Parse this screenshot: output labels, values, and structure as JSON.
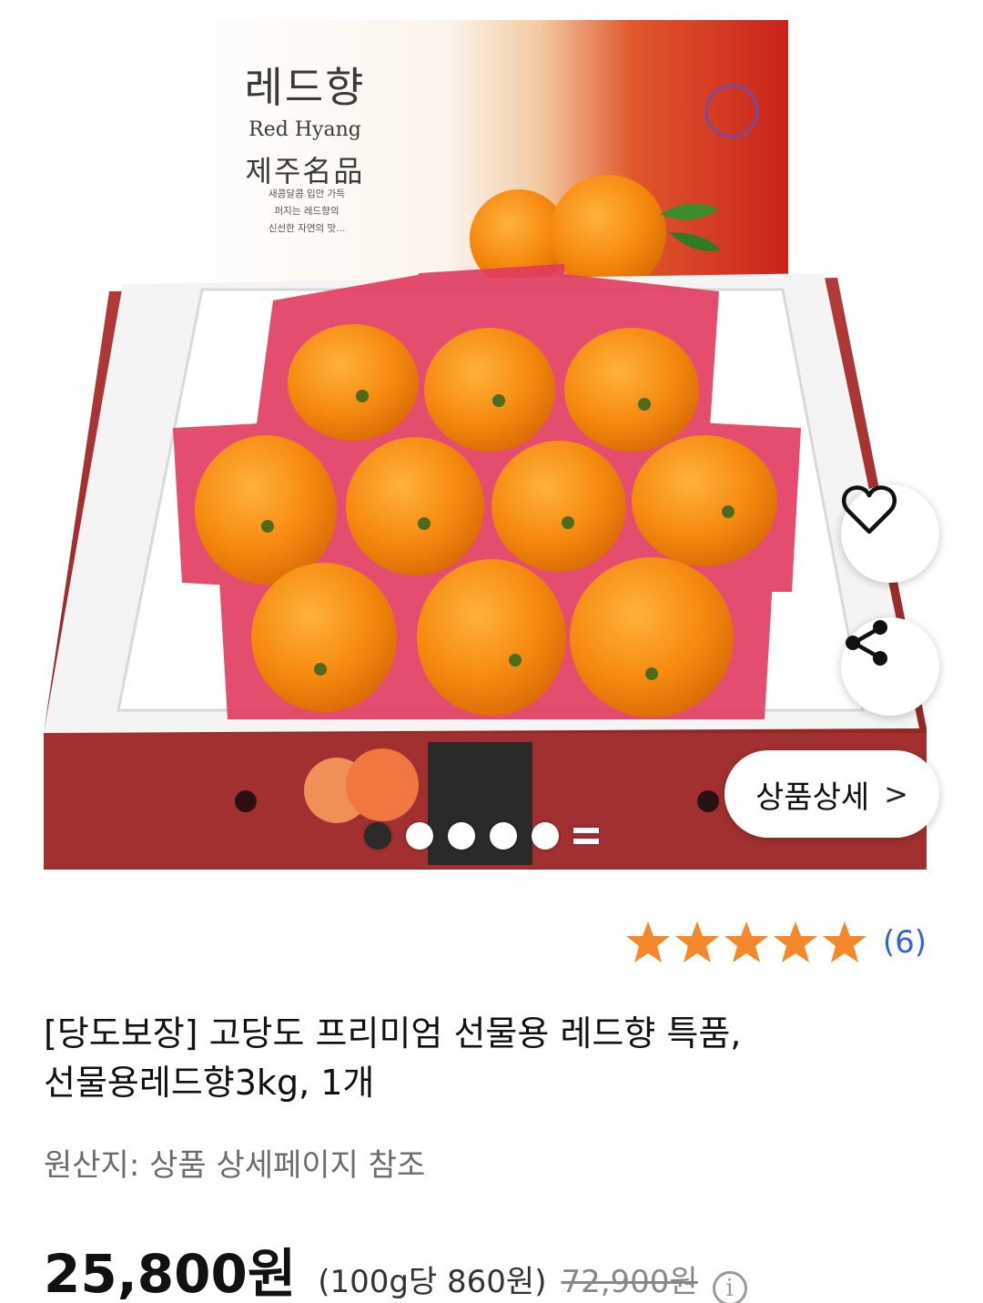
{
  "product_image": {
    "box_title": "레드향",
    "box_subtitle": "Red Hyang",
    "box_tagline": "제주名品",
    "box_description": [
      "새콤달콤 입안 가득",
      "퍼지는 레드향의",
      "신선한 자연의 맛..."
    ],
    "detail_button": "상품상세",
    "detail_chevron": ">",
    "slides_total": 6,
    "slide_active": 1
  },
  "actions": {
    "wishlist_icon": "heart-icon",
    "share_icon": "share-icon"
  },
  "rating": {
    "stars": 5,
    "count_text": "(6)",
    "star_color": "#f5882a"
  },
  "product": {
    "title_line1": "[당도보장] 고당도 프리미엄 선물용 레드향 특품,",
    "title_line2": "선물용레드향3kg, 1개",
    "origin": "원산지: 상품 상세페이지 참조"
  },
  "price": {
    "sale": "25,800원",
    "unit": "(100g당 860원)",
    "original": "72,900원",
    "info_icon": "info-icon"
  }
}
